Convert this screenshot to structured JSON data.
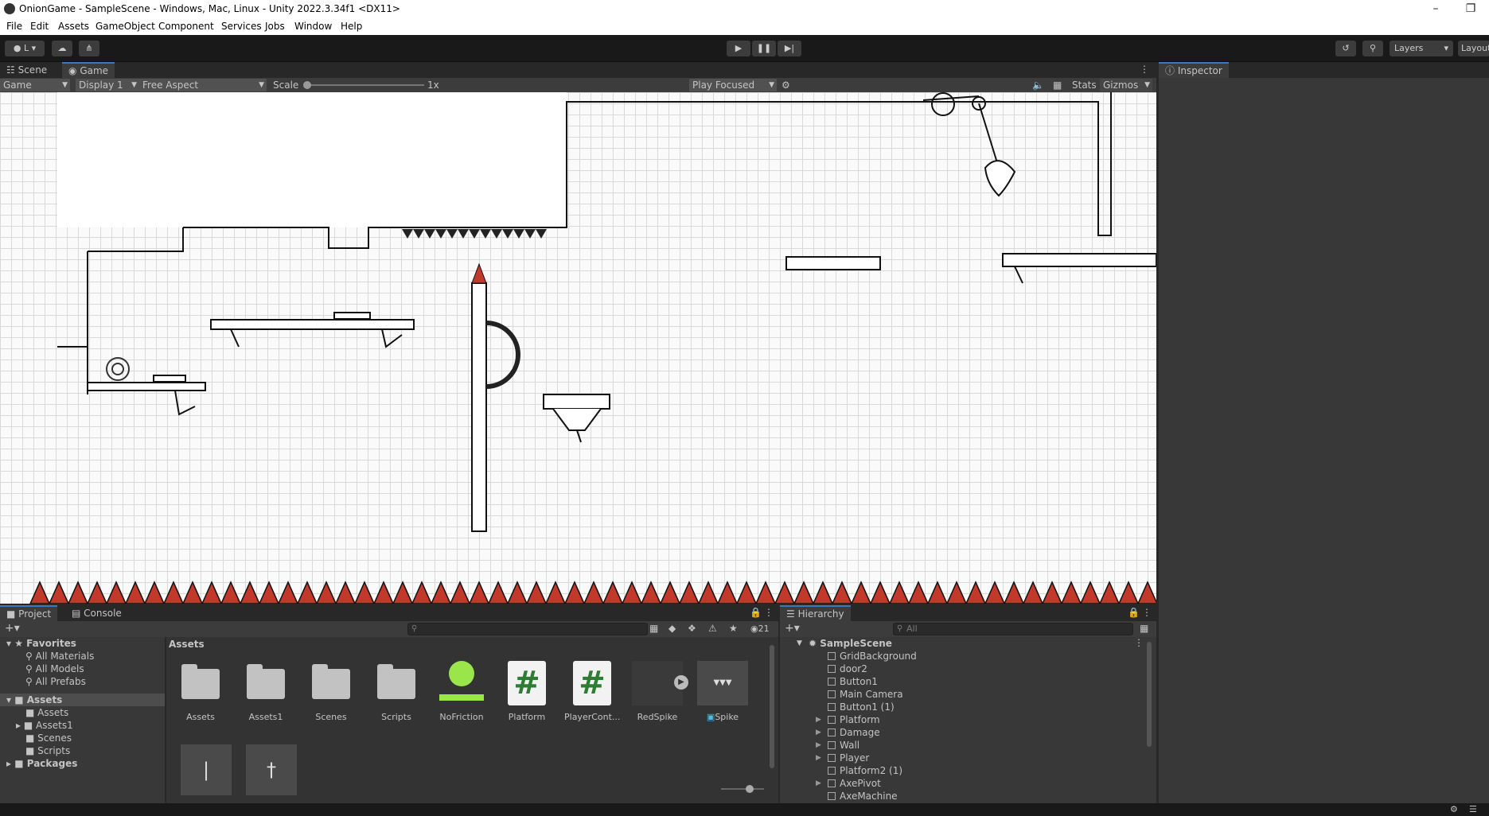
{
  "window": {
    "title": "OnionGame - SampleScene - Windows, Mac, Linux - Unity 2022.3.34f1 <DX11>"
  },
  "menu": [
    "File",
    "Edit",
    "Assets",
    "GameObject",
    "Component",
    "Services",
    "Jobs",
    "Window",
    "Help"
  ],
  "toolbar": {
    "account_label": "L",
    "layers_label": "Layers",
    "layout_label": "Layout"
  },
  "view_tabs": {
    "scene": "Scene",
    "game": "Game"
  },
  "game_bar": {
    "mode": "Game",
    "display": "Display 1",
    "aspect": "Free Aspect",
    "scale_label": "Scale",
    "scale_value": "1x",
    "play_mode": "Play Focused",
    "stats": "Stats",
    "gizmos": "Gizmos"
  },
  "inspector": {
    "tab": "Inspector"
  },
  "project": {
    "tabs": {
      "project": "Project",
      "console": "Console"
    },
    "hidden_count": "21",
    "breadcrumb": "Assets",
    "tree": {
      "favorites": "Favorites",
      "favorite_items": [
        "All Materials",
        "All Models",
        "All Prefabs"
      ],
      "assets": "Assets",
      "asset_children": [
        "Assets",
        "Assets1",
        "Scenes",
        "Scripts"
      ],
      "packages": "Packages"
    },
    "assets": [
      {
        "name": "Assets",
        "kind": "folder"
      },
      {
        "name": "Assets1",
        "kind": "folder"
      },
      {
        "name": "Scenes",
        "kind": "folder"
      },
      {
        "name": "Scripts",
        "kind": "folder"
      },
      {
        "name": "NoFriction",
        "kind": "physics-material"
      },
      {
        "name": "Platform",
        "kind": "script"
      },
      {
        "name": "PlayerCont...",
        "kind": "script"
      },
      {
        "name": "RedSpike",
        "kind": "animation"
      },
      {
        "name": "Spike",
        "kind": "prefab"
      }
    ]
  },
  "hierarchy": {
    "tab": "Hierarchy",
    "search_placeholder": "All",
    "scene": "SampleScene",
    "items": [
      {
        "name": "GridBackground",
        "expandable": false
      },
      {
        "name": "door2",
        "expandable": false
      },
      {
        "name": "Button1",
        "expandable": false
      },
      {
        "name": "Main Camera",
        "expandable": false
      },
      {
        "name": "Button1 (1)",
        "expandable": false
      },
      {
        "name": "Platform",
        "expandable": true
      },
      {
        "name": "Damage",
        "expandable": true
      },
      {
        "name": "Wall",
        "expandable": true
      },
      {
        "name": "Player",
        "expandable": true
      },
      {
        "name": "Platform2 (1)",
        "expandable": false
      },
      {
        "name": "AxePivot",
        "expandable": true
      },
      {
        "name": "AxeMachine",
        "expandable": false
      }
    ]
  },
  "colors": {
    "accent": "#3a79bb",
    "spike_red": "#c0392b",
    "script_green": "#2e7d32",
    "material_green": "#9ae64a"
  }
}
